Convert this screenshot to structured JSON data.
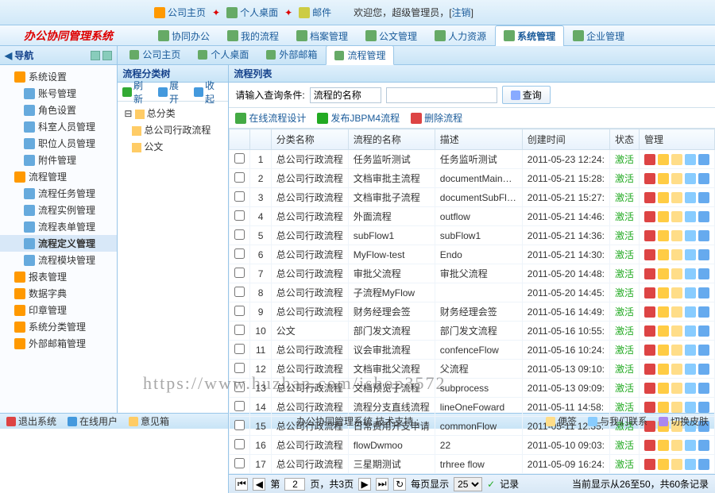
{
  "app_name": "办公协同管理系统",
  "toplinks": [
    "公司主页",
    "个人桌面",
    "邮件"
  ],
  "welcome_prefix": "欢迎您，",
  "welcome_user": "超级管理员",
  "welcome_logout": "注销",
  "menutabs": [
    {
      "label": "协同办公"
    },
    {
      "label": "我的流程"
    },
    {
      "label": "档案管理"
    },
    {
      "label": "公文管理"
    },
    {
      "label": "人力资源"
    },
    {
      "label": "系统管理",
      "active": true
    },
    {
      "label": "企业管理"
    }
  ],
  "nav_title": "导航",
  "nav_tree": [
    {
      "label": "系统设置",
      "l": 0
    },
    {
      "label": "账号管理",
      "l": 1
    },
    {
      "label": "角色设置",
      "l": 1
    },
    {
      "label": "科室人员管理",
      "l": 1
    },
    {
      "label": "职位人员管理",
      "l": 1
    },
    {
      "label": "附件管理",
      "l": 1
    },
    {
      "label": "流程管理",
      "l": 0
    },
    {
      "label": "流程任务管理",
      "l": 1
    },
    {
      "label": "流程实例管理",
      "l": 1
    },
    {
      "label": "流程表单管理",
      "l": 1
    },
    {
      "label": "流程定义管理",
      "l": 1,
      "sel": true
    },
    {
      "label": "流程模块管理",
      "l": 1
    },
    {
      "label": "报表管理",
      "l": 0
    },
    {
      "label": "数据字典",
      "l": 0
    },
    {
      "label": "印章管理",
      "l": 0
    },
    {
      "label": "系统分类管理",
      "l": 0
    },
    {
      "label": "外部邮箱管理",
      "l": 0
    }
  ],
  "content_tabs": [
    {
      "label": "公司主页"
    },
    {
      "label": "个人桌面"
    },
    {
      "label": "外部邮箱"
    },
    {
      "label": "流程管理",
      "active": true
    }
  ],
  "midtree": {
    "title": "流程分类树",
    "toolbar": {
      "refresh": "刷新",
      "expand": "展开",
      "collapse": "收起"
    },
    "nodes": [
      {
        "label": "总分类",
        "l": 0
      },
      {
        "label": "总公司行政流程",
        "l": 1
      },
      {
        "label": "公文",
        "l": 1
      }
    ]
  },
  "list": {
    "title": "流程列表",
    "search_prompt": "请输入查询条件:",
    "search_field": "流程的名称",
    "search_btn": "查询",
    "actions": {
      "design": "在线流程设计",
      "publish": "发布JBPM4流程",
      "delete": "删除流程"
    },
    "columns": [
      "",
      "",
      "分类名称",
      "流程的名称",
      "描述",
      "创建时间",
      "状态",
      "管理"
    ],
    "rows": [
      {
        "n": 1,
        "cat": "总公司行政流程",
        "name": "任务监听测试",
        "desc": "任务监听测试",
        "time": "2011-05-23 12:24:",
        "status": "激活"
      },
      {
        "n": 2,
        "cat": "总公司行政流程",
        "name": "文档审批主流程",
        "desc": "documentMainFlow",
        "time": "2011-05-21 15:28:",
        "status": "激活"
      },
      {
        "n": 3,
        "cat": "总公司行政流程",
        "name": "文档审批子流程",
        "desc": "documentSubFlow",
        "time": "2011-05-21 15:27:",
        "status": "激活"
      },
      {
        "n": 4,
        "cat": "总公司行政流程",
        "name": "外面流程",
        "desc": "outflow",
        "time": "2011-05-21 14:46:",
        "status": "激活"
      },
      {
        "n": 5,
        "cat": "总公司行政流程",
        "name": "subFlow1",
        "desc": "subFlow1",
        "time": "2011-05-21 14:36:",
        "status": "激活"
      },
      {
        "n": 6,
        "cat": "总公司行政流程",
        "name": "MyFlow-test",
        "desc": "Endo",
        "time": "2011-05-21 14:30:",
        "status": "激活"
      },
      {
        "n": 7,
        "cat": "总公司行政流程",
        "name": "审批父流程",
        "desc": "审批父流程",
        "time": "2011-05-20 14:48:",
        "status": "激活"
      },
      {
        "n": 8,
        "cat": "总公司行政流程",
        "name": "子流程MyFlow",
        "desc": "",
        "time": "2011-05-20 14:45:",
        "status": "激活"
      },
      {
        "n": 9,
        "cat": "总公司行政流程",
        "name": "财务经理会签",
        "desc": "财务经理会签",
        "time": "2011-05-16 14:49:",
        "status": "激活"
      },
      {
        "n": 10,
        "cat": "公文",
        "name": "部门发文流程",
        "desc": "部门发文流程",
        "time": "2011-05-16 10:55:",
        "status": "激活"
      },
      {
        "n": 11,
        "cat": "总公司行政流程",
        "name": "议会审批流程",
        "desc": "confenceFlow",
        "time": "2011-05-16 10:24:",
        "status": "激活"
      },
      {
        "n": 12,
        "cat": "总公司行政流程",
        "name": "文档审批父流程",
        "desc": "父流程",
        "time": "2011-05-13 09:10:",
        "status": "激活"
      },
      {
        "n": 13,
        "cat": "总公司行政流程",
        "name": "文档预览子流程",
        "desc": "subprocess",
        "time": "2011-05-13 09:09:",
        "status": "激活"
      },
      {
        "n": 14,
        "cat": "总公司行政流程",
        "name": "流程分支直线流程",
        "desc": "lineOneFoward",
        "time": "2011-05-11 14:58:",
        "status": "激活"
      },
      {
        "n": 15,
        "cat": "总公司行政流程",
        "name": "日常费用开支申请",
        "desc": "commonFlow",
        "time": "2011-05-11 12:35:",
        "status": "激活"
      },
      {
        "n": 16,
        "cat": "总公司行政流程",
        "name": "flowDwmoo",
        "desc": "22",
        "time": "2011-05-10 09:03:",
        "status": "激活"
      },
      {
        "n": 17,
        "cat": "总公司行政流程",
        "name": "三星期测试",
        "desc": "trhree flow",
        "time": "2011-05-09 16:24:",
        "status": "激活"
      }
    ],
    "pager": {
      "page_label_pre": "第",
      "page": "2",
      "page_label_post": "页，共3页",
      "per_label": "每页显示",
      "per": "25",
      "records": "记录",
      "summary": "当前显示从26至50，共60条记录"
    }
  },
  "statusbar": {
    "exit": "退出系统",
    "online": "在线用户",
    "feedback": "意见箱",
    "center": "办公协同管理系统  技术支持 :",
    "note": "便签",
    "contact": "与我们联系",
    "skin": "切换皮肤"
  },
  "watermark": "https://www.huzhan.com/ishop3572"
}
